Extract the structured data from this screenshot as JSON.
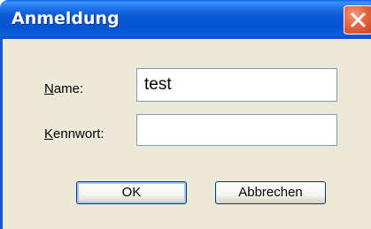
{
  "window": {
    "title": "Anmeldung"
  },
  "icons": {
    "close": "close-icon"
  },
  "colors": {
    "titlebar": "#0a5ad6",
    "dialog_background": "#ece9d8",
    "close_button": "#e66a45"
  },
  "form": {
    "name_label_accel": "N",
    "name_label_rest": "ame:",
    "name_value": "test",
    "password_label_accel": "K",
    "password_label_rest": "ennwort:",
    "password_value": ""
  },
  "buttons": {
    "ok_label": "OK",
    "cancel_label": "Abbrechen"
  }
}
